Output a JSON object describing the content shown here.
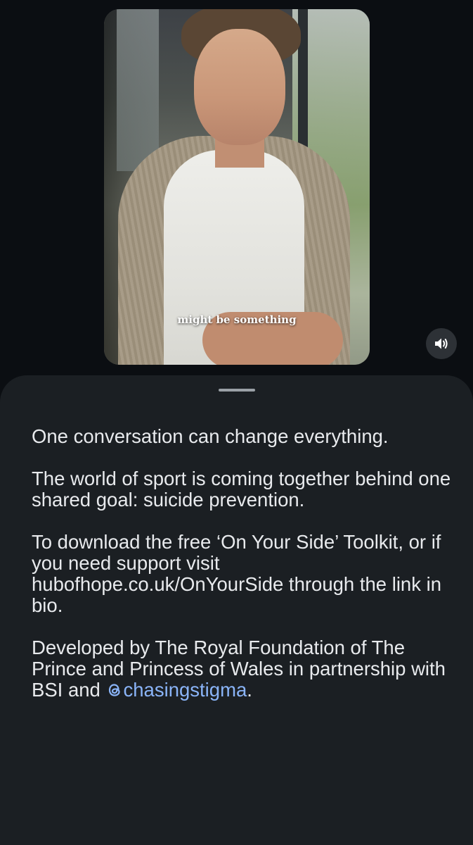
{
  "video": {
    "caption": "might be something"
  },
  "controls": {
    "volume_icon": "volume-icon"
  },
  "post": {
    "paragraphs": [
      "One conversation can change everything.",
      "The world of sport is coming together behind one shared goal: suicide prevention.",
      "To download the free ‘On Your Side’ Toolkit, or if you need support visit hubofhope.co.uk/OnYourSide through the link in bio."
    ],
    "last_paragraph_text": "Developed by The Royal Foundation of The Prince and Princess of Wales in partnership with BSI and ",
    "mention_handle": "chasingstigma",
    "mention_icon": "threads-icon",
    "last_paragraph_end": "."
  },
  "colors": {
    "background": "#0b0e12",
    "sheet": "#1b1f23",
    "text": "#e8eaed",
    "mention": "#8ab4f8"
  }
}
